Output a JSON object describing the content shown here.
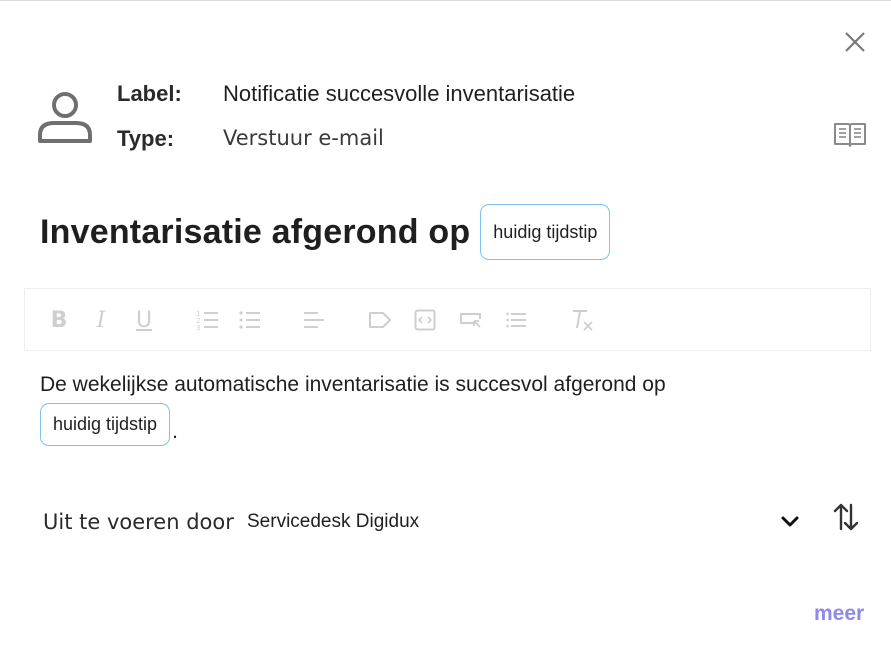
{
  "header": {
    "label_key": "Label:",
    "label_value": "Notificatie succesvolle inventarisatie",
    "type_key": "Type:",
    "type_value": "Verstuur e-mail",
    "icons": [
      "close-icon",
      "user-icon",
      "book-icon"
    ]
  },
  "subject": {
    "text": "Inventarisatie afgerond op",
    "variable": "huidig tijdstip"
  },
  "toolbar": {
    "buttons": [
      "bold",
      "italic",
      "underline",
      "ordered-list",
      "bullet-list",
      "align-left",
      "tag",
      "code",
      "link-input",
      "list",
      "clear-format"
    ],
    "bold_glyph": "B",
    "italic_glyph": "I",
    "underline_glyph": "U"
  },
  "body": {
    "text": "De wekelijkse automatische inventarisatie is succesvol afgerond op",
    "variable": "huidig tijdstip",
    "trailing": "."
  },
  "execution": {
    "label": "Uit te voeren door",
    "value": "Servicedesk Digidux"
  },
  "footer": {
    "more_label": "meer"
  },
  "colors": {
    "chip_border": "#7fc0ee",
    "link": "#8e8ae6",
    "toolbar_icon": "#cfcfcf",
    "icon": "#6f6f6f"
  }
}
